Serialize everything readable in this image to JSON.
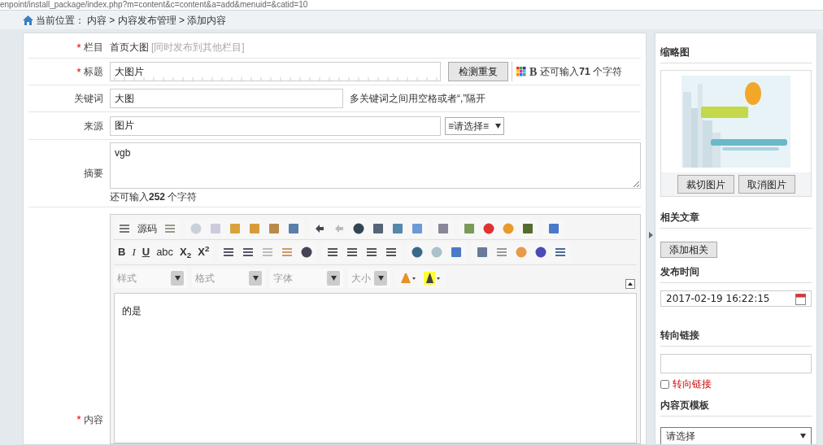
{
  "address_bar": {
    "url": "enpoint/install_package/index.php?m=content&c=content&a=add&menuid=&catid=10"
  },
  "breadcrumb": {
    "label": "当前位置：",
    "path": "内容 > 内容发布管理 > 添加内容"
  },
  "form": {
    "category": {
      "label": "栏目",
      "required": true,
      "value": "首页大图",
      "link": "[同时发布到其他栏目]"
    },
    "title": {
      "label": "标题",
      "required": true,
      "value": "大图片",
      "check_button": "检测重复",
      "bold_toggle": "B",
      "remaining": "还可输入**71** 个字符"
    },
    "keywords": {
      "label": "关键词",
      "required": false,
      "value": "大图",
      "hint": "多关键词之间用空格或者“,”隔开"
    },
    "source": {
      "label": "来源",
      "required": false,
      "value": "图片",
      "select": "≡请选择≡"
    },
    "summary": {
      "label": "摘要",
      "required": false,
      "value": "vgb",
      "remaining": "还可输入**252** 个字符"
    },
    "content": {
      "label": "内容",
      "required": true,
      "editor": {
        "source_button": "源码",
        "format_buttons": [
          "B",
          "I",
          "U",
          "abc",
          "X$_{2}$",
          "X$^{2}$"
        ],
        "dropdowns": [
          "样式",
          "格式",
          "字体",
          "大小"
        ],
        "text": "的是"
      }
    }
  },
  "sidebar": {
    "thumbnail": {
      "heading": "缩略图",
      "buttons": [
        "裁切图片",
        "取消图片"
      ]
    },
    "related": {
      "heading": "相关文章",
      "button": "添加相关"
    },
    "publish_time": {
      "heading": "发布时间",
      "value": "2017-02-19 16:22:15"
    },
    "redirect": {
      "heading": "转向链接",
      "checkbox_label": "转向链接",
      "checked": false
    },
    "template": {
      "heading": "内容页模板",
      "select": "请选择"
    }
  }
}
